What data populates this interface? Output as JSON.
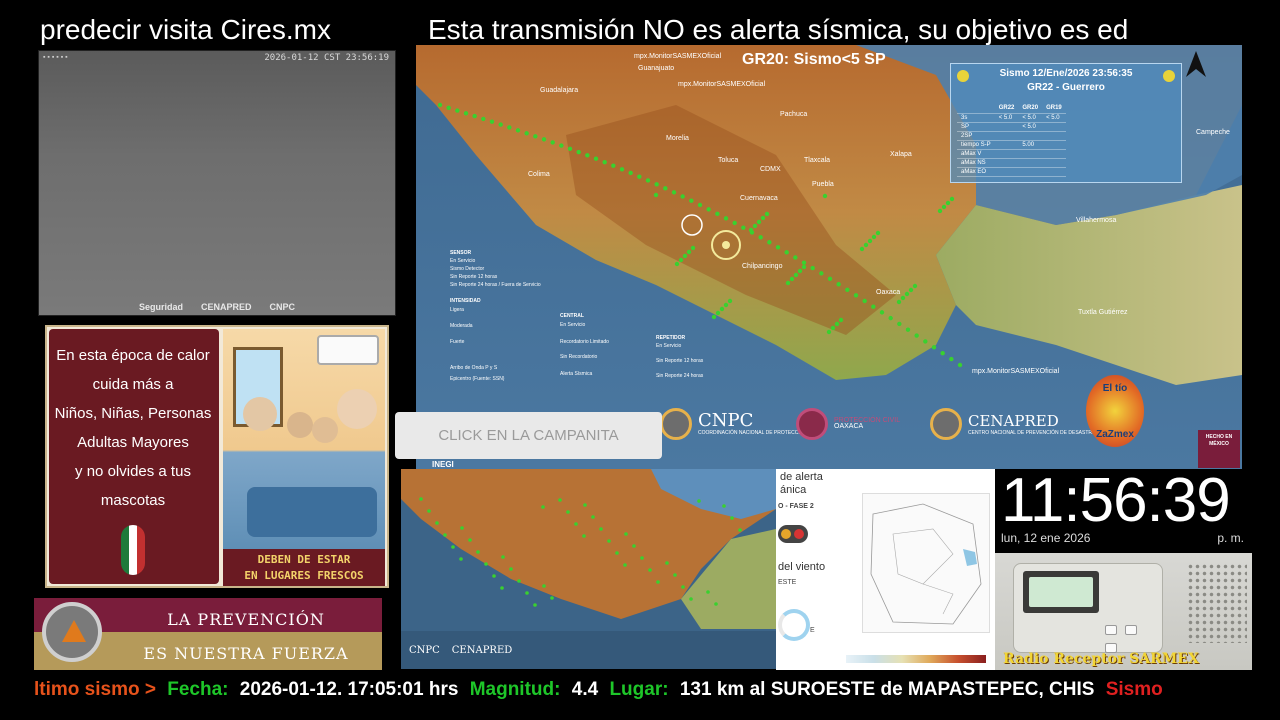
{
  "banners": {
    "left": "predecir visita Cires.mx",
    "right": "Esta transmisión NO es alerta sísmica,  su objetivo es ed"
  },
  "camera": {
    "timestamp": "2026-01-12 CST 23:56:19",
    "logos": [
      "Seguridad",
      "CENAPRED",
      "CNPC"
    ]
  },
  "heat_card": {
    "lines": [
      "En esta época de calor",
      "cuida más a",
      "Niños, Niñas, Personas",
      "Adultas Mayores",
      "y no olvides a tus",
      "mascotas"
    ],
    "footer_l1": "DEBEN DE ESTAR",
    "footer_l2": "EN LUGARES FRESCOS"
  },
  "prevention": {
    "line1": "LA PREVENCIÓN",
    "line2": "ES NUESTRA FUERZA"
  },
  "main_map": {
    "header": "GR20: Sismo<5 SP",
    "credits": [
      "mpx.MonitorSASMEXOficial",
      "mpx.MonitorSASMEXOficial",
      "mpx.MonitorSASMEXOficial"
    ],
    "cities": [
      "Guanajuato",
      "Guadalajara",
      "Pachuca",
      "Morelia",
      "Toluca",
      "CDMX",
      "Tlaxcala",
      "Xalapa",
      "Puebla",
      "Cuernavaca",
      "Colima",
      "Chilpancingo",
      "Oaxaca",
      "Villahermosa",
      "Tuxtla Gutiérrez",
      "Campeche"
    ],
    "info_panel": {
      "title": "Sismo 12/Ene/2026 23:56:35",
      "subtitle": "GR22 - Guerrero",
      "columns": [
        "GR22",
        "GR20",
        "GR19"
      ],
      "rows": [
        {
          "label": "3s",
          "values": [
            "< 5.0",
            "< 5.0",
            "< 5.0"
          ]
        },
        {
          "label": "SP",
          "values": [
            "",
            "< 5.0",
            ""
          ]
        },
        {
          "label": "2SP",
          "values": [
            "",
            "",
            ""
          ]
        },
        {
          "label": "tiempo S-P",
          "values": [
            "",
            "5.00",
            ""
          ]
        },
        {
          "label": "aMax V",
          "values": [
            "",
            "",
            ""
          ]
        },
        {
          "label": "aMax NS",
          "values": [
            "",
            "",
            ""
          ]
        },
        {
          "label": "aMax EO",
          "values": [
            "",
            "",
            ""
          ]
        }
      ]
    },
    "legend": {
      "sensor_title": "SENSOR",
      "sensor_items": [
        "En Servicio",
        "Sismo Detector",
        "Sin Reporte 12 horas",
        "Sin Reporte 24 horas / Fuera de Servicio"
      ],
      "intensidad_title": "INTENSIDAD",
      "intensidad_items": [
        "Ligera",
        "Moderada",
        "Fuerte",
        "Arribo de Onda P y S",
        "Epicentro (Fuente: SSN)"
      ],
      "central_title": "CENTRAL",
      "central_items": [
        "En Servicio",
        "Recordatorio Limitado",
        "Sin Recordatorio",
        "Alerta Sísmica"
      ],
      "repetidor_title": "REPETIDOR",
      "repetidor_items": [
        "En Servicio",
        "Sin Reporte 12 horas",
        "Sin Reporte 24 horas"
      ]
    },
    "orgs": {
      "cnpc": "CNPC",
      "cnpc_sub": "COORDINACIÓN NACIONAL DE PROTECCIÓN CIVIL",
      "pc": "PROTECCIÓN CIVIL",
      "pc_sub": "OAXACA",
      "cenapred": "CENAPRED",
      "cenapred_sub": "CENTRO NACIONAL DE PREVENCIÓN DE DESASTRES",
      "inegi": "INEGI",
      "stamp": "HECHO EN MÉXICO",
      "eltio_top": "El tío",
      "eltio_bottom": "ZaZmex"
    }
  },
  "click_button": {
    "label": "CLICK EN LA CAMPANITA"
  },
  "mini_map": {
    "orgs": [
      "CNPC",
      "CENAPRED"
    ]
  },
  "wind_panel": {
    "title_l1": "de alerta",
    "title_l2": "ánica",
    "phase": "O - FASE 2",
    "wind_label": "del viento",
    "wind_sub": "ESTE",
    "dial_label": "E"
  },
  "clock": {
    "time": "11:56:39",
    "date": "lun, 12 ene 2026",
    "ampm": "p. m."
  },
  "radio": {
    "label": "Radio Receptor SARMEX"
  },
  "ticker": {
    "prefix": "ltimo sismo >",
    "fecha_label": "Fecha:",
    "fecha_value": "2026-01-12. 17:05:01 hrs",
    "magnitud_label": "Magnitud:",
    "magnitud_value": "4.4",
    "lugar_label": "Lugar:",
    "lugar_value": "131 km al SUROESTE de MAPASTEPEC, CHIS",
    "suffix": "Sismo"
  },
  "colors": {
    "ticker_label": "#1ec629",
    "ticker_prefix": "#e6521b",
    "ticker_alert": "#e02020",
    "station": "#39d12f",
    "ocean": "#4b78a1",
    "land": "#b8773a"
  },
  "icons": [
    "north-arrow-icon",
    "bell-icon",
    "civil-protection-icon"
  ]
}
